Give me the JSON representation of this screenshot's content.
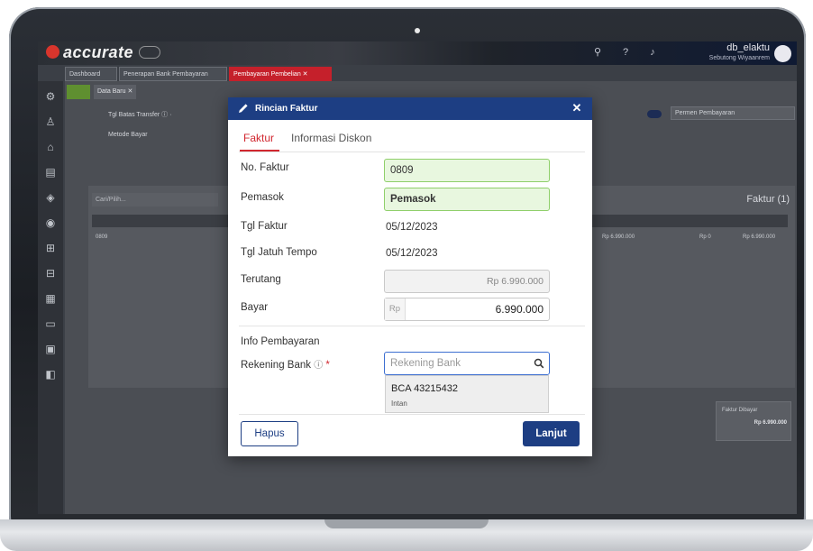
{
  "app": {
    "logo": "accurate",
    "user_name": "db_elaktu",
    "user_sub": "Sebutong Wiyaanrem"
  },
  "tabs": [
    {
      "label": "Dashboard"
    },
    {
      "label": "Penerapan Bank Pembayaran"
    },
    {
      "label": "Pembayaran Pembelian",
      "close": "✕"
    }
  ],
  "subtab": {
    "label": "Data Baru",
    "close": "✕"
  },
  "background_form": {
    "tgl_label": "Tgl Batas Transfer ⓘ ·",
    "metode_label": "Metode Bayar",
    "search_placeholder": "Cari/Pilih...",
    "faktur_count": "Faktur (1)",
    "row_no": "0809",
    "row_total": "Rp 6.990.000",
    "row_diskon": "Rp 0",
    "row_bayar": "Rp 6.990.000",
    "mode_label": "Permen Pembayaran",
    "summary_label": "Faktur Dibayar",
    "summary_value": "Rp 6.990.000"
  },
  "modal": {
    "title": "Rincian Faktur",
    "close": "✕",
    "tabs": [
      {
        "label": "Faktur",
        "active": true
      },
      {
        "label": "Informasi Diskon",
        "active": false
      }
    ],
    "fields": {
      "no_faktur_label": "No. Faktur",
      "no_faktur_value": "0809",
      "pemasok_label": "Pemasok",
      "pemasok_value": "Pemasok",
      "tgl_faktur_label": "Tgl Faktur",
      "tgl_faktur_value": "05/12/2023",
      "tgl_jatuh_tempo_label": "Tgl Jatuh Tempo",
      "tgl_jatuh_tempo_value": "05/12/2023",
      "terutang_label": "Terutang",
      "terutang_value": "Rp 6.990.000",
      "bayar_label": "Bayar",
      "bayar_prefix": "Rp",
      "bayar_value": "6.990.000"
    },
    "info_section_title": "Info Pembayaran",
    "rekening_label": "Rekening Bank",
    "rekening_info": "ⓘ",
    "rekening_required": "*",
    "rekening_placeholder": "Rekening Bank",
    "dropdown_options": [
      {
        "account": "BCA 43215432",
        "holder": "Intan"
      }
    ],
    "buttons": {
      "hapus": "Hapus",
      "lanjut": "Lanjut"
    }
  },
  "colors": {
    "header_blue": "#1d3e83",
    "accent_red": "#d1272f",
    "valid_green": "#e8f7df"
  }
}
